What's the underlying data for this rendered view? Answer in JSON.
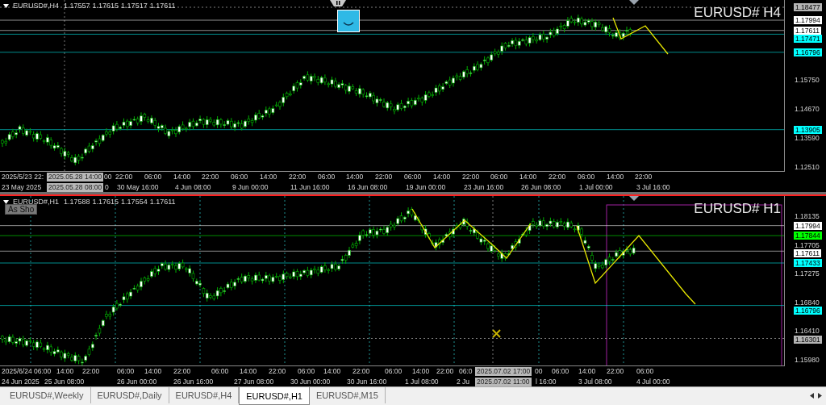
{
  "panels": [
    {
      "symbol": "EURUSD#,H4",
      "ohlc": [
        "1.17557",
        "1.17615",
        "1.17517",
        "1.17611"
      ],
      "title": "EURUSD# H4",
      "selected": false,
      "prices": [
        {
          "kind": "marker",
          "value": "1.18477",
          "color": "#b4b4b4"
        },
        {
          "kind": "tag",
          "value": "1.17994",
          "color": "#ffffff"
        },
        {
          "kind": "tag",
          "value": "1.17611",
          "color": "#ffffff"
        },
        {
          "kind": "tag",
          "value": "1.17471",
          "color": "#00ffff"
        },
        {
          "kind": "tag",
          "value": "1.16796",
          "color": "#00ffff"
        },
        {
          "kind": "tick",
          "value": "1.15750"
        },
        {
          "kind": "tick",
          "value": "1.14670"
        },
        {
          "kind": "tag",
          "value": "1.13905",
          "color": "#00ffff"
        },
        {
          "kind": "tick",
          "value": "1.13590"
        },
        {
          "kind": "tick",
          "value": "1.12510"
        }
      ],
      "time_rows": [
        [
          "2025/5/23 22:",
          "00",
          "22:00",
          "06:00",
          "14:00",
          "22:00",
          "06:00",
          "14:00",
          "22:00",
          "06:00",
          "14:00",
          "22:00",
          "06:00",
          "14:00",
          "22:00",
          "06:00",
          "14:00",
          "22:00",
          "06:00",
          "14:00",
          "22:00"
        ],
        [
          "23 May 2025",
          "0",
          "30 May 16:00",
          "4 Jun 08:00",
          "9 Jun 00:00",
          "11 Jun 16:00",
          "16 Jun 08:00",
          "19 Jun 00:00",
          "23 Jun 16:00",
          "26 Jun 08:00",
          "1 Jul 00:00",
          "3 Jul 16:00"
        ]
      ],
      "crosshair": [
        "2025.05.28 14:00",
        "2025.05.28 08:00"
      ]
    },
    {
      "symbol": "EURUSD#,H1",
      "ohlc": [
        "1.17588",
        "1.17615",
        "1.17554",
        "1.17611"
      ],
      "title": "EURUSD# H1",
      "selected": true,
      "overlay_button": "As Sho",
      "prices": [
        {
          "kind": "tick",
          "value": "1.18135"
        },
        {
          "kind": "tag",
          "value": "1.17994",
          "color": "#ffffff"
        },
        {
          "kind": "tag",
          "value": "1.17844",
          "color": "#00ff00"
        },
        {
          "kind": "tick",
          "value": "1.17705"
        },
        {
          "kind": "tag",
          "value": "1.17611",
          "color": "#ffffff"
        },
        {
          "kind": "tag",
          "value": "1.17433",
          "color": "#00ffff"
        },
        {
          "kind": "tick",
          "value": "1.17275"
        },
        {
          "kind": "tick",
          "value": "1.16840"
        },
        {
          "kind": "tag",
          "value": "1.16796",
          "color": "#00ffff"
        },
        {
          "kind": "tick",
          "value": "1.16410"
        },
        {
          "kind": "marker",
          "value": "1.16301",
          "color": "#b4b4b4"
        },
        {
          "kind": "tick",
          "value": "1.15980"
        }
      ],
      "time_rows": [
        [
          "2025/6/24",
          "06:00",
          "14:00",
          "22:00",
          "06:00",
          "14:00",
          "22:00",
          "06:00",
          "14:00",
          "22:00",
          "06:00",
          "14:00",
          "22:00",
          "06:00",
          "14:00",
          "22:00",
          "06:0",
          "00",
          "06:00",
          "14:00",
          "22:00",
          "06:00"
        ],
        [
          "24 Jun 2025",
          "25 Jun 08:00",
          "26 Jun 00:00",
          "26 Jun 16:00",
          "27 Jun 08:00",
          "30 Jun 00:00",
          "30 Jun 16:00",
          "1 Jul 08:00",
          "2 Ju",
          "l 16:00",
          "3 Jul 08:00",
          "4 Jul 00:00"
        ]
      ],
      "crosshair": [
        "2025.07.02 17:00",
        "2025.07.02 11:00"
      ]
    }
  ],
  "tabs": [
    {
      "label": "EURUSD#,Weekly",
      "selected": false
    },
    {
      "label": "EURUSD#,Daily",
      "selected": false
    },
    {
      "label": "EURUSD#,H4",
      "selected": false
    },
    {
      "label": "EURUSD#,H1",
      "selected": true
    },
    {
      "label": "EURUSD#,M15",
      "selected": false
    }
  ]
}
